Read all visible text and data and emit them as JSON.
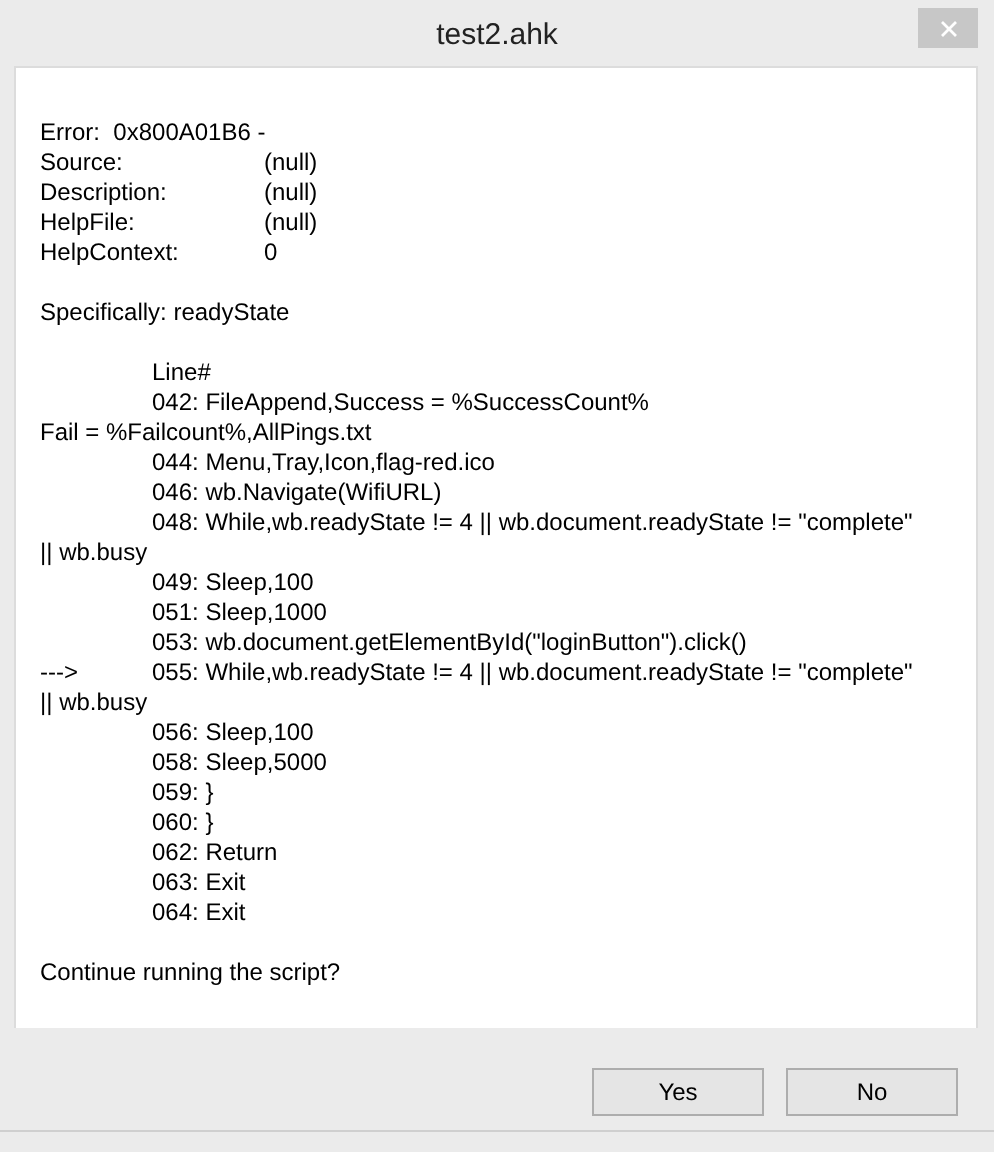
{
  "window": {
    "title": "test2.ahk"
  },
  "error_line": "Error:  0x800A01B6 -",
  "fields": [
    {
      "label": "Source:",
      "value": "(null)"
    },
    {
      "label": "Description:",
      "value": "(null)"
    },
    {
      "label": "HelpFile:",
      "value": "(null)"
    },
    {
      "label": "HelpContext:",
      "value": "0"
    }
  ],
  "specifically": "Specifically: readyState",
  "lines": [
    {
      "kind": "indented",
      "text": "Line#"
    },
    {
      "kind": "indented",
      "text": "042: FileAppend,Success = %SuccessCount%"
    },
    {
      "kind": "wrapped",
      "text": "Fail = %Failcount%,AllPings.txt"
    },
    {
      "kind": "indented",
      "text": "044: Menu,Tray,Icon,flag-red.ico"
    },
    {
      "kind": "indented",
      "text": "046: wb.Navigate(WifiURL)"
    },
    {
      "kind": "indented",
      "text": "048: While,wb.readyState != 4 || wb.document.readyState != \"complete\""
    },
    {
      "kind": "wrapped",
      "text": "|| wb.busy"
    },
    {
      "kind": "indented",
      "text": "049: Sleep,100"
    },
    {
      "kind": "indented",
      "text": "051: Sleep,1000"
    },
    {
      "kind": "indented",
      "text": "053: wb.document.getElementById(\"loginButton\").click()"
    },
    {
      "kind": "current",
      "marker": "--->",
      "text": "055: While,wb.readyState != 4 || wb.document.readyState != \"complete\""
    },
    {
      "kind": "wrapped",
      "text": "|| wb.busy"
    },
    {
      "kind": "indented",
      "text": "056: Sleep,100"
    },
    {
      "kind": "indented",
      "text": "058: Sleep,5000"
    },
    {
      "kind": "indented",
      "text": "059: }"
    },
    {
      "kind": "indented",
      "text": "060: }"
    },
    {
      "kind": "indented",
      "text": "062: Return"
    },
    {
      "kind": "indented",
      "text": "063: Exit"
    },
    {
      "kind": "indented",
      "text": "064: Exit"
    }
  ],
  "question": "Continue running the script?",
  "buttons": [
    "Yes",
    "No"
  ]
}
